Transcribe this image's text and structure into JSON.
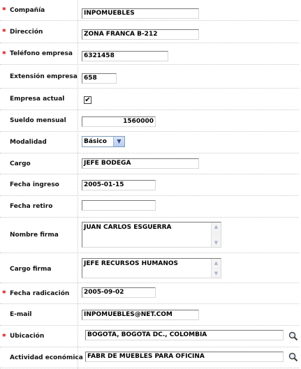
{
  "fields": {
    "compania": {
      "label": "Compañía",
      "value": "INPOMUEBLES"
    },
    "direccion": {
      "label": "Dirección",
      "value": "ZONA FRANCA B-212"
    },
    "telefono": {
      "label": "Teléfono empresa",
      "value": "6321458"
    },
    "extension": {
      "label": "Extensión empresa",
      "value": "658"
    },
    "empresa_actual": {
      "label": "Empresa actual",
      "checked": true,
      "mark": "✔"
    },
    "sueldo": {
      "label": "Sueldo mensual",
      "value": "1560000"
    },
    "modalidad": {
      "label": "Modalidad",
      "value": "Básico"
    },
    "cargo": {
      "label": "Cargo",
      "value": "JEFE BODEGA"
    },
    "fecha_ingreso": {
      "label": "Fecha ingreso",
      "value": "2005-01-15"
    },
    "fecha_retiro": {
      "label": "Fecha retiro",
      "value": ""
    },
    "nombre_firma": {
      "label": "Nombre firma",
      "value": "JUAN CARLOS ESGUERRA"
    },
    "cargo_firma": {
      "label": "Cargo firma",
      "value": "JEFE RECURSOS HUMANOS"
    },
    "fecha_radicacion": {
      "label": "Fecha radicación",
      "value": "2005-09-02"
    },
    "email": {
      "label": "E-mail",
      "value": "INPOMUEBLES@NET.COM"
    },
    "ubicacion": {
      "label": "Ubicación",
      "value": "BOGOTA, BOGOTA DC., COLOMBIA"
    },
    "actividad": {
      "label": "Actividad económica",
      "value": "FABR DE MUEBLES PARA OFICINA"
    }
  },
  "required_marker": "*",
  "colors": {
    "required": "#d40000",
    "select_border": "#7f9db9"
  },
  "icons": {
    "scroll_up": "▲",
    "scroll_down": "▼",
    "dropdown": "▼",
    "search": "magnifier-icon"
  }
}
